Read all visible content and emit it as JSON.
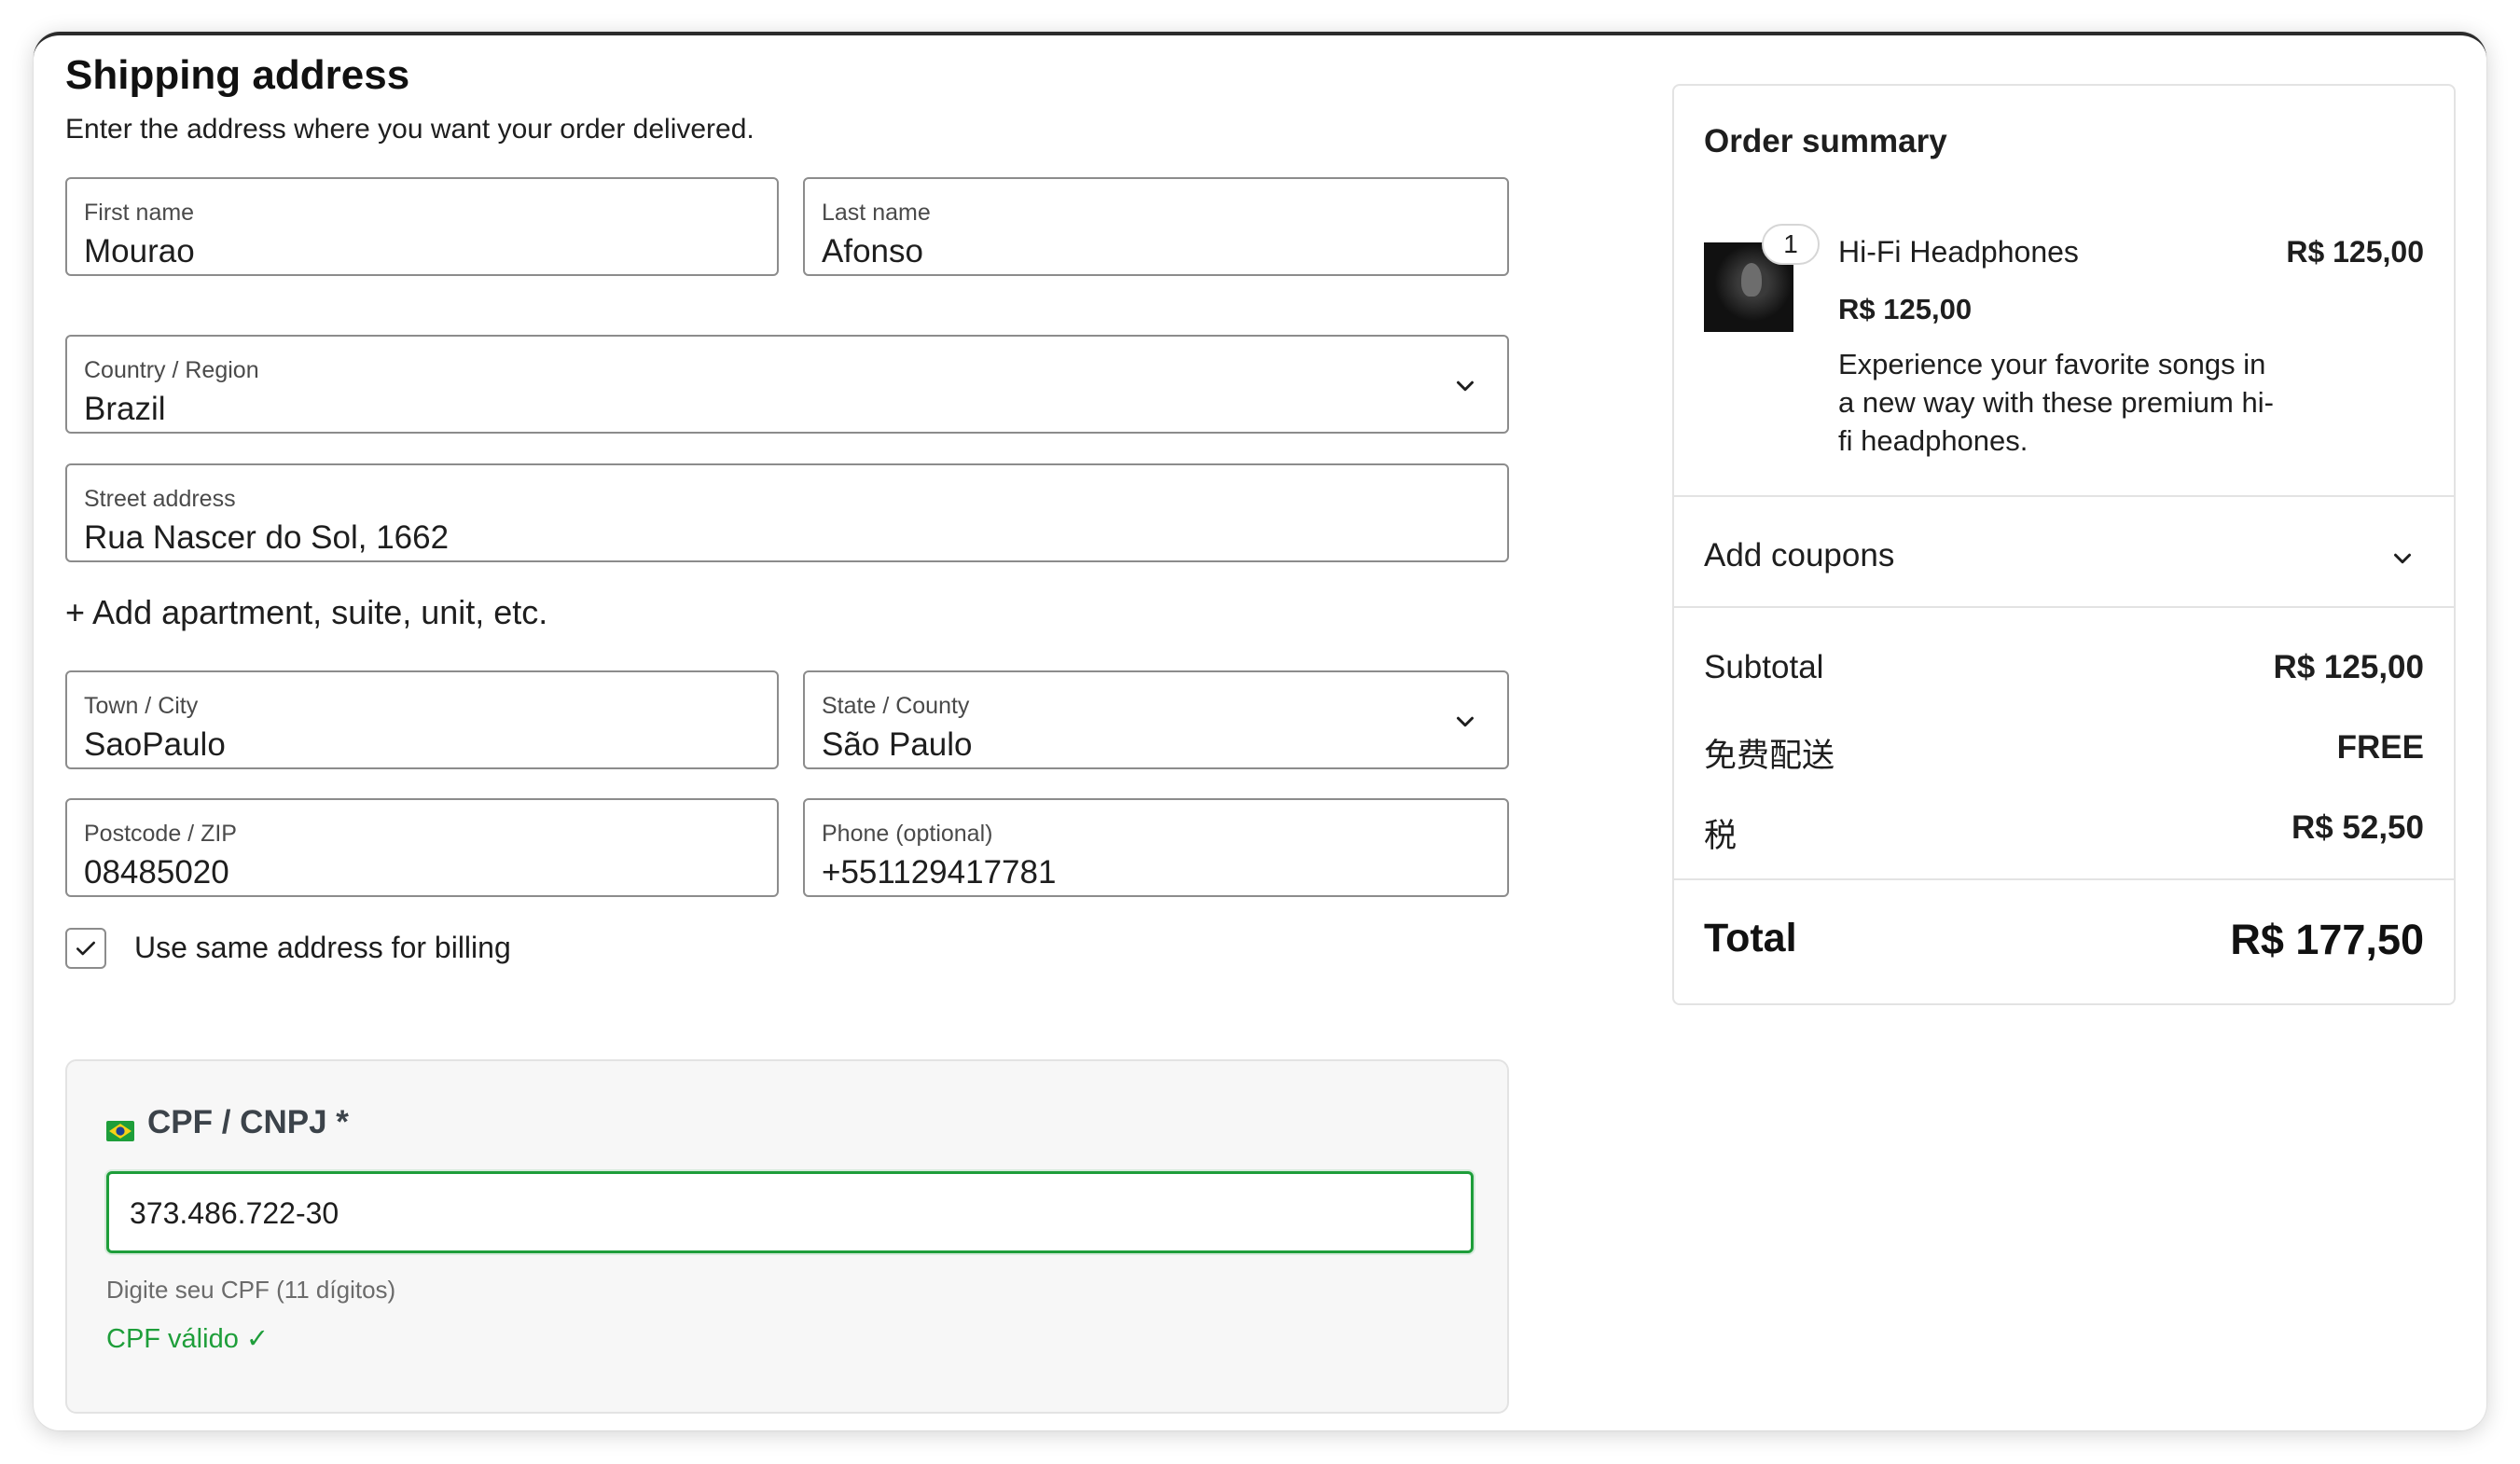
{
  "shipping": {
    "title": "Shipping address",
    "subtitle": "Enter the address where you want your order delivered.",
    "first_name": {
      "label": "First name",
      "value": "Mourao"
    },
    "last_name": {
      "label": "Last name",
      "value": "Afonso"
    },
    "country": {
      "label": "Country / Region",
      "value": "Brazil"
    },
    "street": {
      "label": "Street address",
      "value": "Rua Nascer do Sol, 1662"
    },
    "add_apartment": "+ Add apartment, suite, unit, etc.",
    "city": {
      "label": "Town / City",
      "value": "SaoPaulo"
    },
    "state": {
      "label": "State / County",
      "value": "São Paulo"
    },
    "postcode": {
      "label": "Postcode / ZIP",
      "value": "08485020"
    },
    "phone": {
      "label": "Phone (optional)",
      "value": "+551129417781"
    },
    "same_billing": {
      "label": "Use same address for billing",
      "checked": true
    }
  },
  "cpf": {
    "title": "CPF / CNPJ *",
    "value": "373.486.722-30",
    "help": "Digite seu CPF (11 dígitos)",
    "valid": "CPF válido ✓"
  },
  "summary": {
    "title": "Order summary",
    "item": {
      "quantity": "1",
      "name": "Hi-Fi Headphones",
      "line_total": "R$ 125,00",
      "unit_price": "R$ 125,00",
      "description": "Experience your favorite songs in a new way with these premium hi-fi headphones."
    },
    "coupons_label": "Add coupons",
    "subtotal_label": "Subtotal",
    "subtotal_value": "R$ 125,00",
    "shipping_label": "免费配送",
    "shipping_value": "FREE",
    "tax_label": "税",
    "tax_value": "R$ 52,50",
    "total_label": "Total",
    "total_value": "R$ 177,50"
  },
  "colors": {
    "valid_green": "#1e9e3a",
    "border_gray": "#8c8c8c",
    "panel_bg": "#f7f7f7"
  }
}
